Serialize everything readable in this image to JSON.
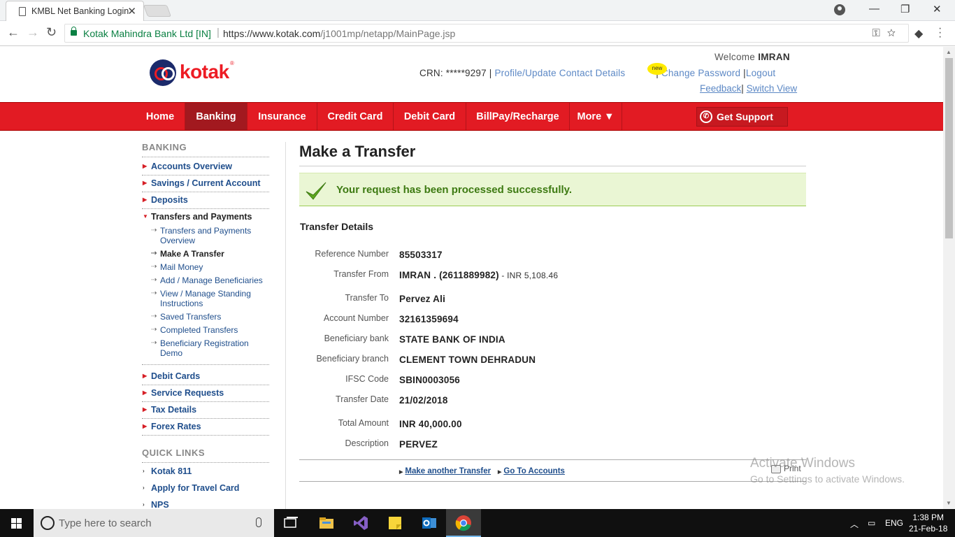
{
  "browser": {
    "tab_title": "KMBL Net Banking Login",
    "tab_close": "✕",
    "secure_name": "Kotak Mahindra Bank Ltd [IN]",
    "url_host": "https://www.kotak.com",
    "url_path": "/j1001mp/netapp/MainPage.jsp",
    "omni_icons": "⚿☆",
    "window_controls": [
      "—",
      "❐",
      "✕"
    ]
  },
  "header": {
    "logo_text": "kotak",
    "welcome_label": "Welcome",
    "welcome_name": "IMRAN",
    "crn_label": "CRN: *****9297 |",
    "profile_link": "Profile/Update Contact Details",
    "new_badge": "new",
    "sep1": "|",
    "change_password": "Change Password",
    "sep2": "|",
    "logout": "Logout",
    "feedback": "Feedback",
    "sep3": "|",
    "switch_view": "Switch View"
  },
  "nav": {
    "items": [
      {
        "label": "Home"
      },
      {
        "label": "Banking"
      },
      {
        "label": "Insurance"
      },
      {
        "label": "Credit Card"
      },
      {
        "label": "Debit Card"
      },
      {
        "label": "BillPay/Recharge"
      },
      {
        "label": "More ▼"
      }
    ],
    "support": "Get Support"
  },
  "sidebar": {
    "heading": "BANKING",
    "items": [
      {
        "label": "Accounts Overview"
      },
      {
        "label": "Savings / Current Account"
      },
      {
        "label": "Deposits"
      },
      {
        "label": "Transfers and Payments"
      },
      {
        "label": "Debit Cards"
      },
      {
        "label": "Service Requests"
      },
      {
        "label": "Tax Details"
      },
      {
        "label": "Forex Rates"
      }
    ],
    "subitems": [
      {
        "label": "Transfers and Payments Overview"
      },
      {
        "label": "Make A Transfer"
      },
      {
        "label": "Mail Money"
      },
      {
        "label": "Add / Manage Beneficiaries"
      },
      {
        "label": "View / Manage Standing Instructions"
      },
      {
        "label": "Saved Transfers"
      },
      {
        "label": "Completed Transfers"
      },
      {
        "label": "Beneficiary Registration Demo"
      }
    ],
    "quick_heading": "QUICK LINKS",
    "quick_links": [
      {
        "label": "Kotak 811"
      },
      {
        "label": "Apply for Travel Card"
      },
      {
        "label": "NPS"
      }
    ]
  },
  "main": {
    "title": "Make a Transfer",
    "success_message": "Your request has been processed successfully.",
    "section_title": "Transfer Details",
    "rows": [
      {
        "label": "Reference Number",
        "value": "85503317"
      },
      {
        "label": "Transfer From",
        "value": "IMRAN . (2611889982)",
        "extra": " - INR 5,108.46"
      },
      {
        "label": "Transfer To",
        "value": "Pervez Ali"
      },
      {
        "label": "Account Number",
        "value": "32161359694"
      },
      {
        "label": "Beneficiary bank",
        "value": "STATE BANK OF INDIA"
      },
      {
        "label": "Beneficiary branch",
        "value": "CLEMENT TOWN DEHRADUN"
      },
      {
        "label": "IFSC Code",
        "value": "SBIN0003056"
      },
      {
        "label": "Transfer Date",
        "value": "21/02/2018"
      },
      {
        "label": "Total Amount",
        "value": "INR 40,000.00"
      },
      {
        "label": "Description",
        "value": "PERVEZ"
      }
    ],
    "make_another": "Make another Transfer",
    "go_to_accounts": "Go To Accounts",
    "print": "Print"
  },
  "watermark": {
    "line1": "Activate Windows",
    "line2": "Go to Settings to activate Windows."
  },
  "taskbar": {
    "search_placeholder": "Type here to search",
    "lang": "ENG",
    "time": "1:38 PM",
    "date": "21-Feb-18"
  }
}
